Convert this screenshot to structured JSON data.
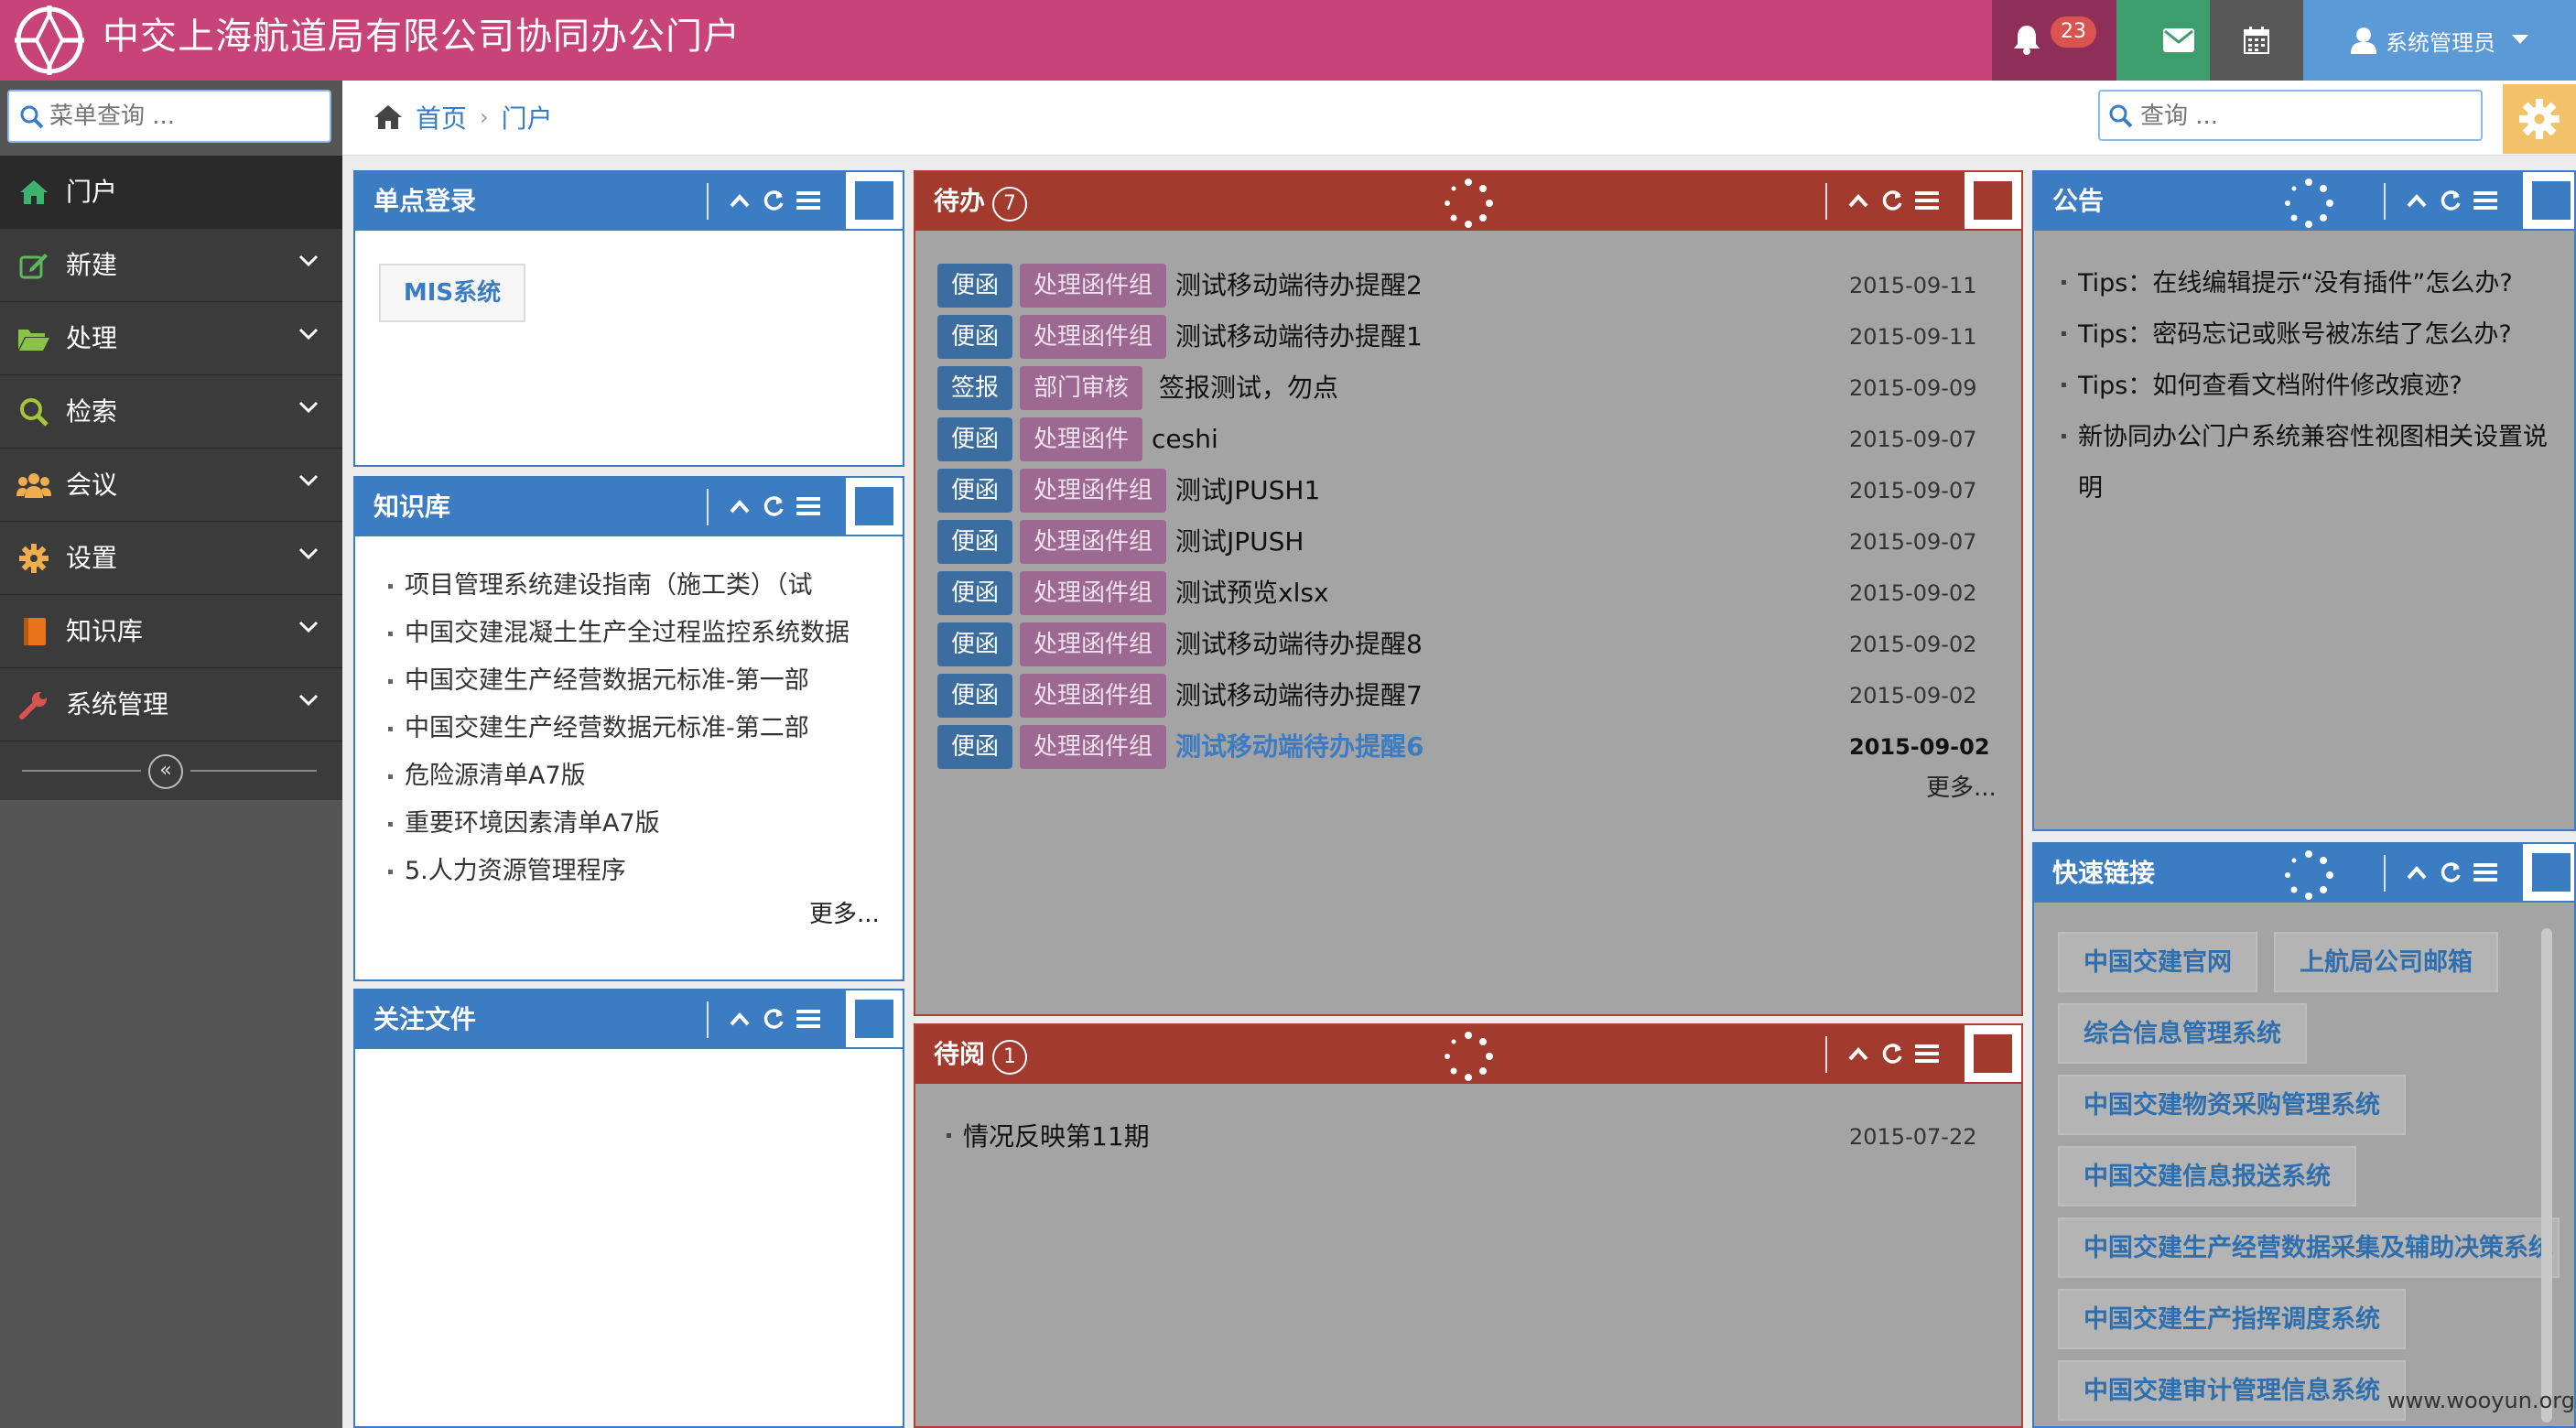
{
  "app": {
    "title": "中交上海航道局有限公司协同办公门户"
  },
  "topbar": {
    "notifications_count": "23",
    "user_label": "系统管理员"
  },
  "sidebar": {
    "search_placeholder": "菜单查询 ...",
    "items": [
      {
        "label": "门户",
        "icon": "home-icon",
        "color": "#3cb46e"
      },
      {
        "label": "新建",
        "icon": "edit-icon",
        "color": "#5cb85c"
      },
      {
        "label": "处理",
        "icon": "folder-icon",
        "color": "#8bc34a"
      },
      {
        "label": "检索",
        "icon": "search-icon",
        "color": "#a5c53a"
      },
      {
        "label": "会议",
        "icon": "group-icon",
        "color": "#f0ad4e"
      },
      {
        "label": "设置",
        "icon": "gear-icon",
        "color": "#f0ad4e"
      },
      {
        "label": "知识库",
        "icon": "book-icon",
        "color": "#e8731b"
      },
      {
        "label": "系统管理",
        "icon": "wrench-icon",
        "color": "#d9534f"
      }
    ]
  },
  "breadcrumb": {
    "home": "首页",
    "current": "门户"
  },
  "top_search": {
    "placeholder": "查询 ..."
  },
  "panels": {
    "sso": {
      "title": "单点登录",
      "button": "MIS系统"
    },
    "knowledge": {
      "title": "知识库",
      "items": [
        "项目管理系统建设指南（施工类）（试",
        "中国交建混凝土生产全过程监控系统数据",
        "中国交建生产经营数据元标准-第一部",
        "中国交建生产经营数据元标准-第二部",
        "危险源清单A7版",
        "重要环境因素清单A7版",
        "5.人力资源管理程序"
      ],
      "more": "更多..."
    },
    "follow": {
      "title": "关注文件"
    },
    "todo": {
      "title": "待办",
      "count": "7",
      "rows": [
        {
          "type": "便函",
          "group": "处理函件组",
          "title": "测试移动端待办提醒2",
          "date": "2015-09-11"
        },
        {
          "type": "便函",
          "group": "处理函件组",
          "title": "测试移动端待办提醒1",
          "date": "2015-09-11"
        },
        {
          "type": "签报",
          "group": "部门审核",
          "title": "签报测试，勿点",
          "date": "2015-09-09"
        },
        {
          "type": "便函",
          "group": "处理函件",
          "title": "ceshi",
          "date": "2015-09-07"
        },
        {
          "type": "便函",
          "group": "处理函件组",
          "title": "测试JPUSH1",
          "date": "2015-09-07"
        },
        {
          "type": "便函",
          "group": "处理函件组",
          "title": "测试JPUSH",
          "date": "2015-09-07"
        },
        {
          "type": "便函",
          "group": "处理函件组",
          "title": "测试预览xlsx",
          "date": "2015-09-02"
        },
        {
          "type": "便函",
          "group": "处理函件组",
          "title": "测试移动端待办提醒8",
          "date": "2015-09-02"
        },
        {
          "type": "便函",
          "group": "处理函件组",
          "title": "测试移动端待办提醒7",
          "date": "2015-09-02"
        },
        {
          "type": "便函",
          "group": "处理函件组",
          "title": "测试移动端待办提醒6",
          "date": "2015-09-02"
        }
      ],
      "more": "更多..."
    },
    "toread": {
      "title": "待阅",
      "count": "1",
      "rows": [
        {
          "title": "情况反映第11期",
          "date": "2015-07-22"
        }
      ]
    },
    "notice": {
      "title": "公告",
      "items": [
        "Tips：在线编辑提示“没有插件”怎么办?",
        "Tips：密码忘记或账号被冻结了怎么办?",
        "Tips：如何查看文档附件修改痕迹?",
        "新协同办公门户系统兼容性视图相关设置说明"
      ]
    },
    "quicklinks": {
      "title": "快速链接",
      "links": [
        "中国交建官网",
        "上航局公司邮箱",
        "综合信息管理系统",
        "中国交建物资采购管理系统",
        "中国交建信息报送系统",
        "中国交建生产经营数据采集及辅助决策系统",
        "中国交建生产指挥调度系统",
        "中国交建审计管理信息系统"
      ]
    }
  },
  "watermark": "www.wooyun.org"
}
